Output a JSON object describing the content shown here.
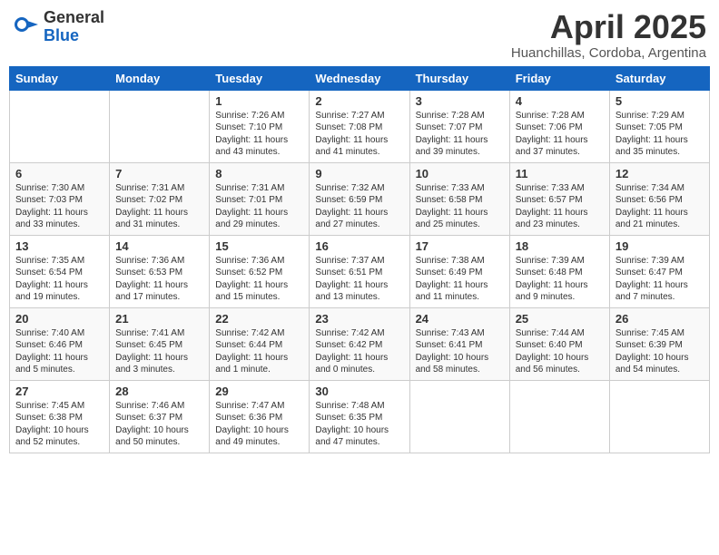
{
  "header": {
    "logo_general": "General",
    "logo_blue": "Blue",
    "title": "April 2025",
    "subtitle": "Huanchillas, Cordoba, Argentina"
  },
  "days_of_week": [
    "Sunday",
    "Monday",
    "Tuesday",
    "Wednesday",
    "Thursday",
    "Friday",
    "Saturday"
  ],
  "weeks": [
    [
      {
        "day": "",
        "info": ""
      },
      {
        "day": "",
        "info": ""
      },
      {
        "day": "1",
        "info": "Sunrise: 7:26 AM\nSunset: 7:10 PM\nDaylight: 11 hours and 43 minutes."
      },
      {
        "day": "2",
        "info": "Sunrise: 7:27 AM\nSunset: 7:08 PM\nDaylight: 11 hours and 41 minutes."
      },
      {
        "day": "3",
        "info": "Sunrise: 7:28 AM\nSunset: 7:07 PM\nDaylight: 11 hours and 39 minutes."
      },
      {
        "day": "4",
        "info": "Sunrise: 7:28 AM\nSunset: 7:06 PM\nDaylight: 11 hours and 37 minutes."
      },
      {
        "day": "5",
        "info": "Sunrise: 7:29 AM\nSunset: 7:05 PM\nDaylight: 11 hours and 35 minutes."
      }
    ],
    [
      {
        "day": "6",
        "info": "Sunrise: 7:30 AM\nSunset: 7:03 PM\nDaylight: 11 hours and 33 minutes."
      },
      {
        "day": "7",
        "info": "Sunrise: 7:31 AM\nSunset: 7:02 PM\nDaylight: 11 hours and 31 minutes."
      },
      {
        "day": "8",
        "info": "Sunrise: 7:31 AM\nSunset: 7:01 PM\nDaylight: 11 hours and 29 minutes."
      },
      {
        "day": "9",
        "info": "Sunrise: 7:32 AM\nSunset: 6:59 PM\nDaylight: 11 hours and 27 minutes."
      },
      {
        "day": "10",
        "info": "Sunrise: 7:33 AM\nSunset: 6:58 PM\nDaylight: 11 hours and 25 minutes."
      },
      {
        "day": "11",
        "info": "Sunrise: 7:33 AM\nSunset: 6:57 PM\nDaylight: 11 hours and 23 minutes."
      },
      {
        "day": "12",
        "info": "Sunrise: 7:34 AM\nSunset: 6:56 PM\nDaylight: 11 hours and 21 minutes."
      }
    ],
    [
      {
        "day": "13",
        "info": "Sunrise: 7:35 AM\nSunset: 6:54 PM\nDaylight: 11 hours and 19 minutes."
      },
      {
        "day": "14",
        "info": "Sunrise: 7:36 AM\nSunset: 6:53 PM\nDaylight: 11 hours and 17 minutes."
      },
      {
        "day": "15",
        "info": "Sunrise: 7:36 AM\nSunset: 6:52 PM\nDaylight: 11 hours and 15 minutes."
      },
      {
        "day": "16",
        "info": "Sunrise: 7:37 AM\nSunset: 6:51 PM\nDaylight: 11 hours and 13 minutes."
      },
      {
        "day": "17",
        "info": "Sunrise: 7:38 AM\nSunset: 6:49 PM\nDaylight: 11 hours and 11 minutes."
      },
      {
        "day": "18",
        "info": "Sunrise: 7:39 AM\nSunset: 6:48 PM\nDaylight: 11 hours and 9 minutes."
      },
      {
        "day": "19",
        "info": "Sunrise: 7:39 AM\nSunset: 6:47 PM\nDaylight: 11 hours and 7 minutes."
      }
    ],
    [
      {
        "day": "20",
        "info": "Sunrise: 7:40 AM\nSunset: 6:46 PM\nDaylight: 11 hours and 5 minutes."
      },
      {
        "day": "21",
        "info": "Sunrise: 7:41 AM\nSunset: 6:45 PM\nDaylight: 11 hours and 3 minutes."
      },
      {
        "day": "22",
        "info": "Sunrise: 7:42 AM\nSunset: 6:44 PM\nDaylight: 11 hours and 1 minute."
      },
      {
        "day": "23",
        "info": "Sunrise: 7:42 AM\nSunset: 6:42 PM\nDaylight: 11 hours and 0 minutes."
      },
      {
        "day": "24",
        "info": "Sunrise: 7:43 AM\nSunset: 6:41 PM\nDaylight: 10 hours and 58 minutes."
      },
      {
        "day": "25",
        "info": "Sunrise: 7:44 AM\nSunset: 6:40 PM\nDaylight: 10 hours and 56 minutes."
      },
      {
        "day": "26",
        "info": "Sunrise: 7:45 AM\nSunset: 6:39 PM\nDaylight: 10 hours and 54 minutes."
      }
    ],
    [
      {
        "day": "27",
        "info": "Sunrise: 7:45 AM\nSunset: 6:38 PM\nDaylight: 10 hours and 52 minutes."
      },
      {
        "day": "28",
        "info": "Sunrise: 7:46 AM\nSunset: 6:37 PM\nDaylight: 10 hours and 50 minutes."
      },
      {
        "day": "29",
        "info": "Sunrise: 7:47 AM\nSunset: 6:36 PM\nDaylight: 10 hours and 49 minutes."
      },
      {
        "day": "30",
        "info": "Sunrise: 7:48 AM\nSunset: 6:35 PM\nDaylight: 10 hours and 47 minutes."
      },
      {
        "day": "",
        "info": ""
      },
      {
        "day": "",
        "info": ""
      },
      {
        "day": "",
        "info": ""
      }
    ]
  ]
}
